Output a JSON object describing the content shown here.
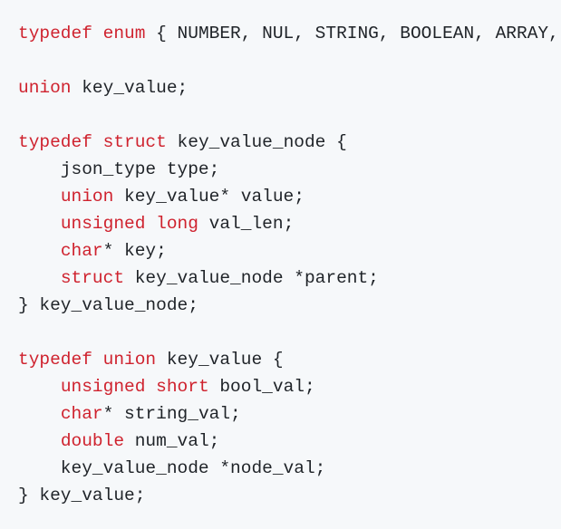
{
  "colors": {
    "background": "#f6f8fa",
    "text": "#1f2328",
    "keyword": "#cf222e"
  },
  "code_lines": [
    [
      [
        "kw",
        "typedef"
      ],
      [
        "t",
        " "
      ],
      [
        "kw",
        "enum"
      ],
      [
        "t",
        " { NUMBER, NUL, STRING, BOOLEAN, ARRAY,"
      ]
    ],
    [],
    [
      [
        "kw",
        "union"
      ],
      [
        "t",
        " key_value;"
      ]
    ],
    [],
    [
      [
        "kw",
        "typedef"
      ],
      [
        "t",
        " "
      ],
      [
        "kw",
        "struct"
      ],
      [
        "t",
        " key_value_node {"
      ]
    ],
    [
      [
        "t",
        "    json_type type;"
      ]
    ],
    [
      [
        "t",
        "    "
      ],
      [
        "kw",
        "union"
      ],
      [
        "t",
        " key_value* value;"
      ]
    ],
    [
      [
        "t",
        "    "
      ],
      [
        "kw",
        "unsigned"
      ],
      [
        "t",
        " "
      ],
      [
        "kw",
        "long"
      ],
      [
        "t",
        " val_len;"
      ]
    ],
    [
      [
        "t",
        "    "
      ],
      [
        "kw",
        "char"
      ],
      [
        "t",
        "* key;"
      ]
    ],
    [
      [
        "t",
        "    "
      ],
      [
        "kw",
        "struct"
      ],
      [
        "t",
        " key_value_node *parent;"
      ]
    ],
    [
      [
        "t",
        "} key_value_node;"
      ]
    ],
    [],
    [
      [
        "kw",
        "typedef"
      ],
      [
        "t",
        " "
      ],
      [
        "kw",
        "union"
      ],
      [
        "t",
        " key_value {"
      ]
    ],
    [
      [
        "t",
        "    "
      ],
      [
        "kw",
        "unsigned"
      ],
      [
        "t",
        " "
      ],
      [
        "kw",
        "short"
      ],
      [
        "t",
        " bool_val;"
      ]
    ],
    [
      [
        "t",
        "    "
      ],
      [
        "kw",
        "char"
      ],
      [
        "t",
        "* string_val;"
      ]
    ],
    [
      [
        "t",
        "    "
      ],
      [
        "kw",
        "double"
      ],
      [
        "t",
        " num_val;"
      ]
    ],
    [
      [
        "t",
        "    key_value_node *node_val;"
      ]
    ],
    [
      [
        "t",
        "} key_value;"
      ]
    ]
  ]
}
